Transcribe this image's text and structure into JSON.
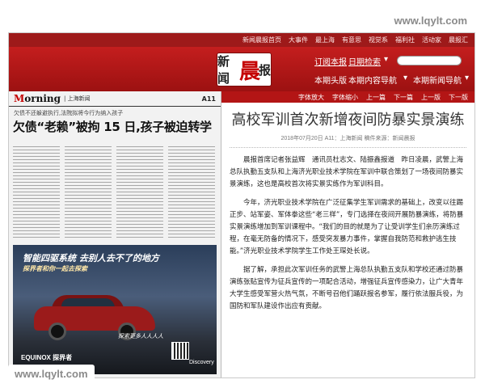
{
  "watermark": {
    "text": "www.lqylt.com"
  },
  "top_nav": {
    "items": [
      "新闻晨报首页",
      "大事件",
      "最上海",
      "有意思",
      "视觉系",
      "福利社",
      "活动家",
      "晨报汇"
    ]
  },
  "masthead": {
    "logo": {
      "part1": "新闻",
      "part2": "晨",
      "part3": "报"
    },
    "subscribe": "订阅本报",
    "date_search": "日期检索",
    "this_edition": "本期头版",
    "this_contents": "本期内容导航",
    "this_news": "本期新闻导航"
  },
  "newspaper": {
    "logo_m": "M",
    "logo_rest": "orning",
    "edition": "| 上海新闻",
    "page_num": "A11",
    "subhead": "欠债不还躲避执行,法院拟将今行为纳入孩子",
    "headline": "欠债“老赖”被拘 15 日,孩子被迫转学"
  },
  "ad": {
    "line1": "智能四驱系统 去别人去不了的地方",
    "line2": "探界者和你一起去探索",
    "tagline": "探索更多人人人人",
    "brand": "EQUINOX 探界者",
    "partner": "Discovery"
  },
  "article": {
    "toolbar": [
      "字体放大",
      "字体缩小",
      "上一篇",
      "下一篇",
      "上一版",
      "下一版"
    ],
    "title": "高校军训首次新增夜间防暴实景演练",
    "meta": "2018年07月20日   A11：上海新闻   稿件来源：新闻晨报",
    "paragraphs": [
      "晨报首席记者张益辉　通讯员杜志文、陆振鑫报道　昨日凌晨，武警上海总队执勤五支队和上海济光职业技术学院在军训中联合策划了一场夜间防暴实景演练，这也是高校首次将实景实练作为军训科目。",
      "今年，济光职业技术学院在广泛征集学生军训需求的基础上，改变以往踢正步、站军姿、军体拳这些“老三样”，专门选择在夜间开展防暴演练，将防暴实景演练增加到军训课程中。“我们的目的就是为了让受训学生们亲历演练过程，在毫无防备的情况下，感受突发暴力事件，掌握自我防范和救护逃生技能。”济光职业技术学院学生工作处王琛处长说。",
      "据了解，承担此次军训任务的武警上海总队执勤五支队和学校还通过防暴演练张贴宣传为征兵宣传的一项配合活动，增强征兵宣传感染力，让广大青年大学生感受军营火热气氛，不断号召他们踊跃报名参军，履行依法服兵役，为国防和军队建设作出应有贡献。"
    ]
  }
}
